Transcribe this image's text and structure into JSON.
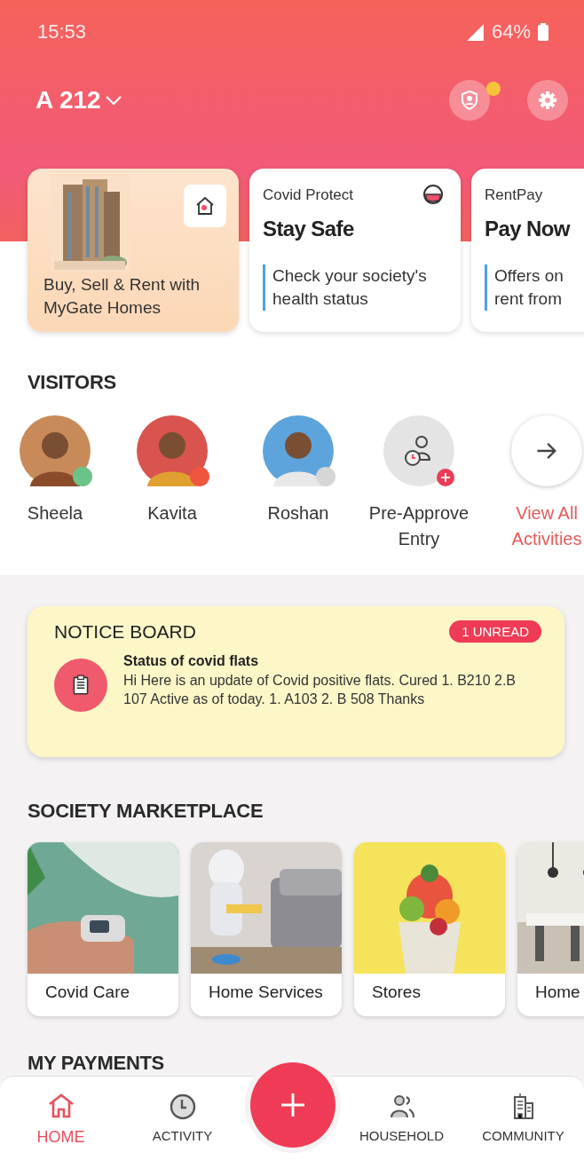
{
  "status_bar": {
    "time": "15:53",
    "battery": "64%"
  },
  "header": {
    "flat": "A 212",
    "alert_dot": true
  },
  "promo_cards": [
    {
      "kind": "homes",
      "lines": [
        "Buy, Sell & Rent with",
        "MyGate Homes"
      ]
    },
    {
      "kind": "info",
      "label": "Covid Protect",
      "title": "Stay Safe",
      "lines": [
        "Check your society's",
        "health status"
      ]
    },
    {
      "kind": "info",
      "label": "RentPay",
      "title": "Pay Now",
      "lines": [
        "Offers on",
        "rent from"
      ]
    }
  ],
  "visitors": {
    "title": "VISITORS",
    "items": [
      {
        "kind": "person",
        "name": "Sheela",
        "color": "#6cc38a"
      },
      {
        "kind": "person",
        "name": "Kavita",
        "color": "#f0553f"
      },
      {
        "kind": "person",
        "name": "Roshan",
        "color": "#d6d6d6"
      },
      {
        "kind": "action",
        "name": "Pre-Approve Entry"
      },
      {
        "kind": "link",
        "name": "View All Activities"
      }
    ]
  },
  "notice_board": {
    "title": "NOTICE BOARD",
    "badge": "1 UNREAD",
    "notice": {
      "title": "Status of covid flats",
      "body": "Hi Here is an update of Covid positive flats. Cured 1. B210 2.B 107 Active as of today. 1. A103 2. B 508 Thanks"
    }
  },
  "marketplace": {
    "title": "SOCIETY MARKETPLACE",
    "items": [
      {
        "label": "Covid Care"
      },
      {
        "label": "Home Services"
      },
      {
        "label": "Stores"
      },
      {
        "label": "Home"
      }
    ]
  },
  "payments": {
    "title": "MY PAYMENTS"
  },
  "nav": [
    {
      "kind": "home",
      "label": "HOME",
      "selected": true
    },
    {
      "kind": "activity",
      "label": "ACTIVITY",
      "selected": false
    },
    {
      "kind": "add"
    },
    {
      "kind": "household",
      "label": "HOUSEHOLD",
      "selected": false
    },
    {
      "kind": "community",
      "label": "COMMUNITY",
      "selected": false
    }
  ]
}
